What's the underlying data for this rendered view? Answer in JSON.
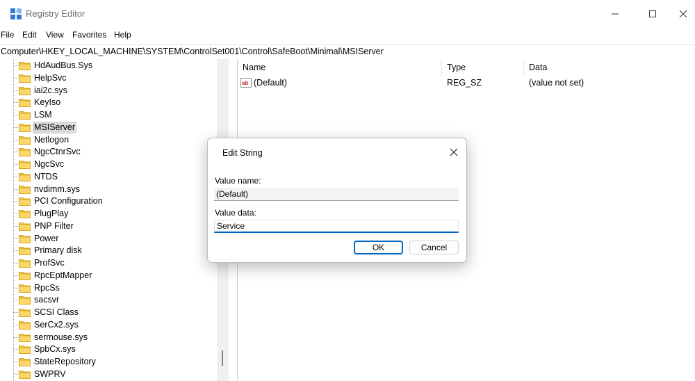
{
  "window": {
    "title": "Registry Editor",
    "icon": "registry-icon"
  },
  "menu": [
    "File",
    "Edit",
    "View",
    "Favorites",
    "Help"
  ],
  "address": "Computer\\HKEY_LOCAL_MACHINE\\SYSTEM\\ControlSet001\\Control\\SafeBoot\\Minimal\\MSIServer",
  "tree": {
    "selected": "MSIServer",
    "items": [
      "HdAudBus.Sys",
      "HelpSvc",
      "iai2c.sys",
      "KeyIso",
      "LSM",
      "MSIServer",
      "Netlogon",
      "NgcCtnrSvc",
      "NgcSvc",
      "NTDS",
      "nvdimm.sys",
      "PCI Configuration",
      "PlugPlay",
      "PNP Filter",
      "Power",
      "Primary disk",
      "ProfSvc",
      "RpcEptMapper",
      "RpcSs",
      "sacsvr",
      "SCSI Class",
      "SerCx2.sys",
      "sermouse.sys",
      "SpbCx.sys",
      "StateRepository",
      "SWPRV"
    ]
  },
  "list": {
    "columns": [
      "Name",
      "Type",
      "Data"
    ],
    "rows": [
      {
        "name": "(Default)",
        "type": "REG_SZ",
        "data": "(value not set)"
      }
    ]
  },
  "dialog": {
    "title": "Edit String",
    "value_name_label": "Value name:",
    "value_name": "(Default)",
    "value_data_label": "Value data:",
    "value_data": "Service",
    "ok_label": "OK",
    "cancel_label": "Cancel"
  },
  "colors": {
    "accent": "#0067c0",
    "folder": "#f3c74f",
    "selected": "#d9d9d9"
  }
}
